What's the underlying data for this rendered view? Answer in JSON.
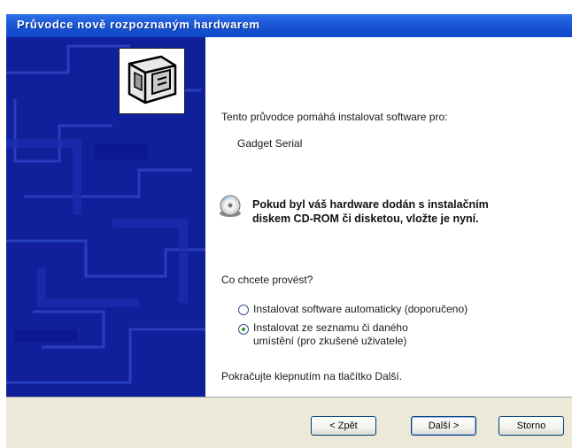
{
  "window": {
    "title": "Průvodce nově rozpoznaným hardwarem"
  },
  "content": {
    "intro": "Tento průvodce pomáhá instalovat software pro:",
    "device_name": "Gadget Serial",
    "cd_notice_line1": "Pokud byl váš hardware dodán s instalačním",
    "cd_notice_line2": "diskem CD-ROM či disketou, vložte je nyní.",
    "question": "Co chcete provést?",
    "options": [
      {
        "label": "Instalovat software automaticky (doporučeno)",
        "selected": false
      },
      {
        "label_line1": "Instalovat ze seznamu či daného",
        "label_line2": "umístění (pro zkušené uživatele)",
        "selected": true
      }
    ],
    "next_hint": "Pokračujte klepnutím na tlačítko Další."
  },
  "buttons": {
    "back": "< Zpět",
    "next": "Další >",
    "cancel": "Storno"
  },
  "icons": {
    "wizard": "hardware-wizard-icon",
    "cd": "cd-rom-icon"
  },
  "colors": {
    "title_bar": "#1a57d8",
    "side_panel": "#101f9a",
    "footer": "#ece9d8"
  }
}
